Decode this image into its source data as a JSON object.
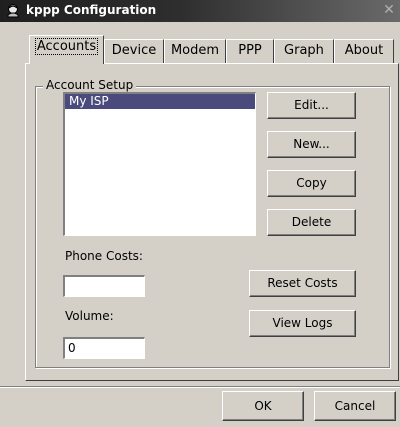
{
  "window": {
    "title": "kppp Configuration",
    "icon": "kppp-app-icon",
    "close_icon": "close-icon"
  },
  "tabs": [
    {
      "label": "Accounts",
      "active": true
    },
    {
      "label": "Device",
      "active": false
    },
    {
      "label": "Modem",
      "active": false
    },
    {
      "label": "PPP",
      "active": false
    },
    {
      "label": "Graph",
      "active": false
    },
    {
      "label": "About",
      "active": false
    }
  ],
  "account_setup": {
    "group_title": "Account Setup",
    "accounts": [
      {
        "name": "My ISP",
        "selected": true
      }
    ],
    "buttons": {
      "edit": "Edit...",
      "new": "New...",
      "copy": "Copy",
      "delete": "Delete"
    },
    "phone_costs_label": "Phone Costs:",
    "phone_costs_value": "",
    "volume_label": "Volume:",
    "volume_value": "0",
    "reset_costs": "Reset Costs",
    "view_logs": "View Logs"
  },
  "dialog_buttons": {
    "ok": "OK",
    "cancel": "Cancel"
  },
  "colors": {
    "selection": "#4b4a7c",
    "face": "#d4d0c8"
  }
}
